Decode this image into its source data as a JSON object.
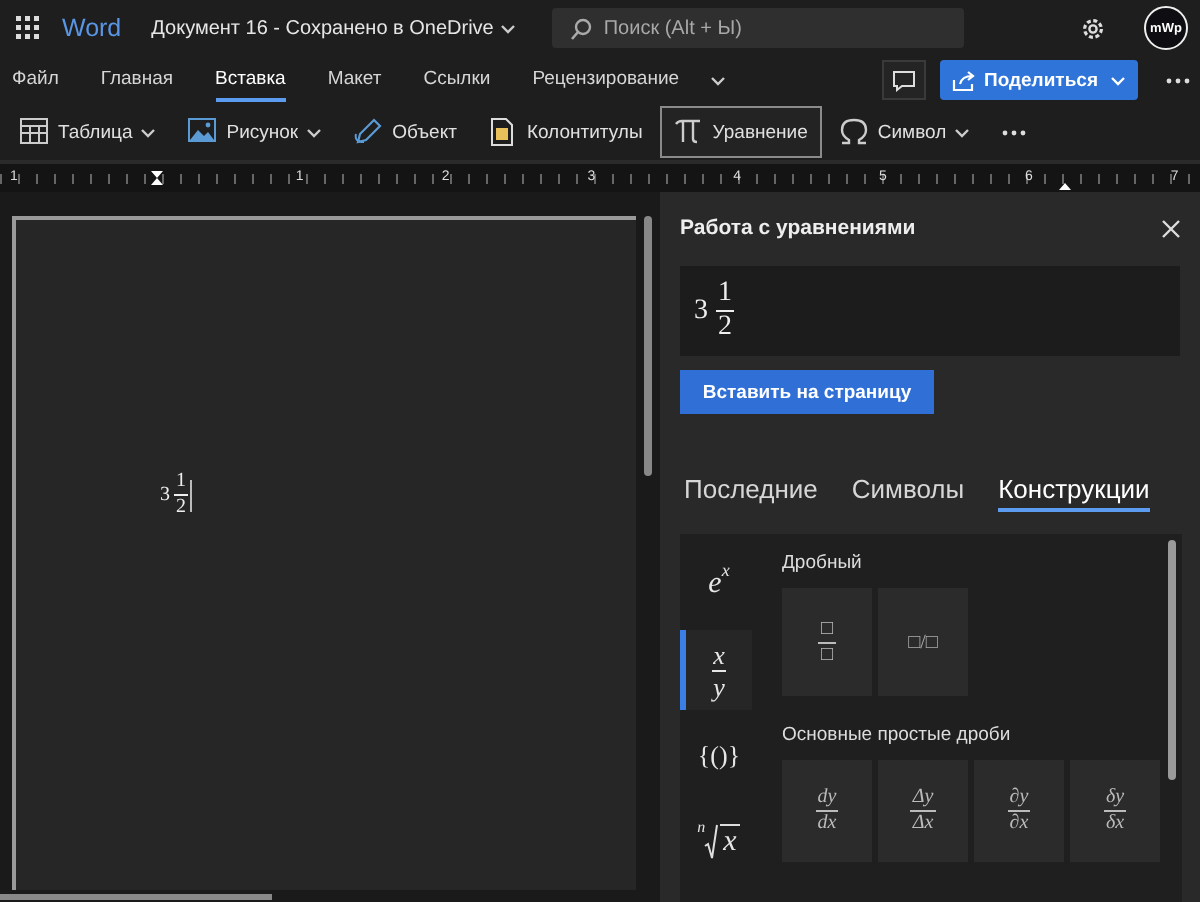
{
  "app": {
    "name": "Word",
    "title": "Документ 16 - Сохранено в OneDrive"
  },
  "search": {
    "placeholder": "Поиск (Alt + Ы)"
  },
  "user": {
    "initials": "mWp"
  },
  "ribbon_tabs": [
    {
      "label": "Файл",
      "selected": false
    },
    {
      "label": "Главная",
      "selected": false
    },
    {
      "label": "Вставка",
      "selected": true
    },
    {
      "label": "Макет",
      "selected": false
    },
    {
      "label": "Ссылки",
      "selected": false
    },
    {
      "label": "Рецензирование",
      "selected": false
    }
  ],
  "share_button": {
    "label": "Поделиться"
  },
  "toolbar": [
    {
      "kind": "table",
      "label": "Таблица",
      "dropdown": true,
      "selected": false
    },
    {
      "kind": "picture",
      "label": "Рисунок",
      "dropdown": true,
      "selected": false
    },
    {
      "kind": "object",
      "label": "Объект",
      "dropdown": false,
      "selected": false
    },
    {
      "kind": "header",
      "label": "Колонтитулы",
      "dropdown": false,
      "selected": false
    },
    {
      "kind": "equation",
      "label": "Уравнение",
      "dropdown": false,
      "selected": true
    },
    {
      "kind": "symbol",
      "label": "Символ",
      "dropdown": true,
      "selected": false
    }
  ],
  "ruler": {
    "numbers": [
      "1",
      "1",
      "2",
      "3",
      "4",
      "5",
      "6",
      "7"
    ]
  },
  "document": {
    "equation": {
      "whole": "3",
      "numerator": "1",
      "denominator": "2"
    }
  },
  "equation_pane": {
    "title": "Работа с уравнениями",
    "preview": {
      "whole": "3",
      "numerator": "1",
      "denominator": "2"
    },
    "insert_button": "Вставить на страницу",
    "tabs": [
      {
        "label": "Последние",
        "selected": false
      },
      {
        "label": "Символы",
        "selected": false
      },
      {
        "label": "Конструкции",
        "selected": true
      }
    ],
    "categories": [
      {
        "kind": "power",
        "base": "e",
        "exponent": "x",
        "selected": false
      },
      {
        "kind": "fraction",
        "numerator": "x",
        "denominator": "y",
        "selected": true
      },
      {
        "kind": "plain",
        "text": "{()}",
        "selected": false
      },
      {
        "kind": "radical",
        "index": "n",
        "radicand": "x",
        "selected": false
      }
    ],
    "sections": [
      {
        "title": "Дробный",
        "tiles": [
          {
            "kind": "stacked",
            "numerator": "□",
            "denominator": "□"
          },
          {
            "kind": "linear",
            "text": "□/□"
          }
        ]
      },
      {
        "title": "Основные простые дроби",
        "tiles": [
          {
            "kind": "stacked",
            "numerator": "dy",
            "denominator": "dx"
          },
          {
            "kind": "stacked",
            "numerator": "Δy",
            "denominator": "Δx"
          },
          {
            "kind": "stacked",
            "numerator": "∂y",
            "denominator": "∂x"
          },
          {
            "kind": "stacked",
            "numerator": "δy",
            "denominator": "δx"
          }
        ]
      }
    ]
  }
}
